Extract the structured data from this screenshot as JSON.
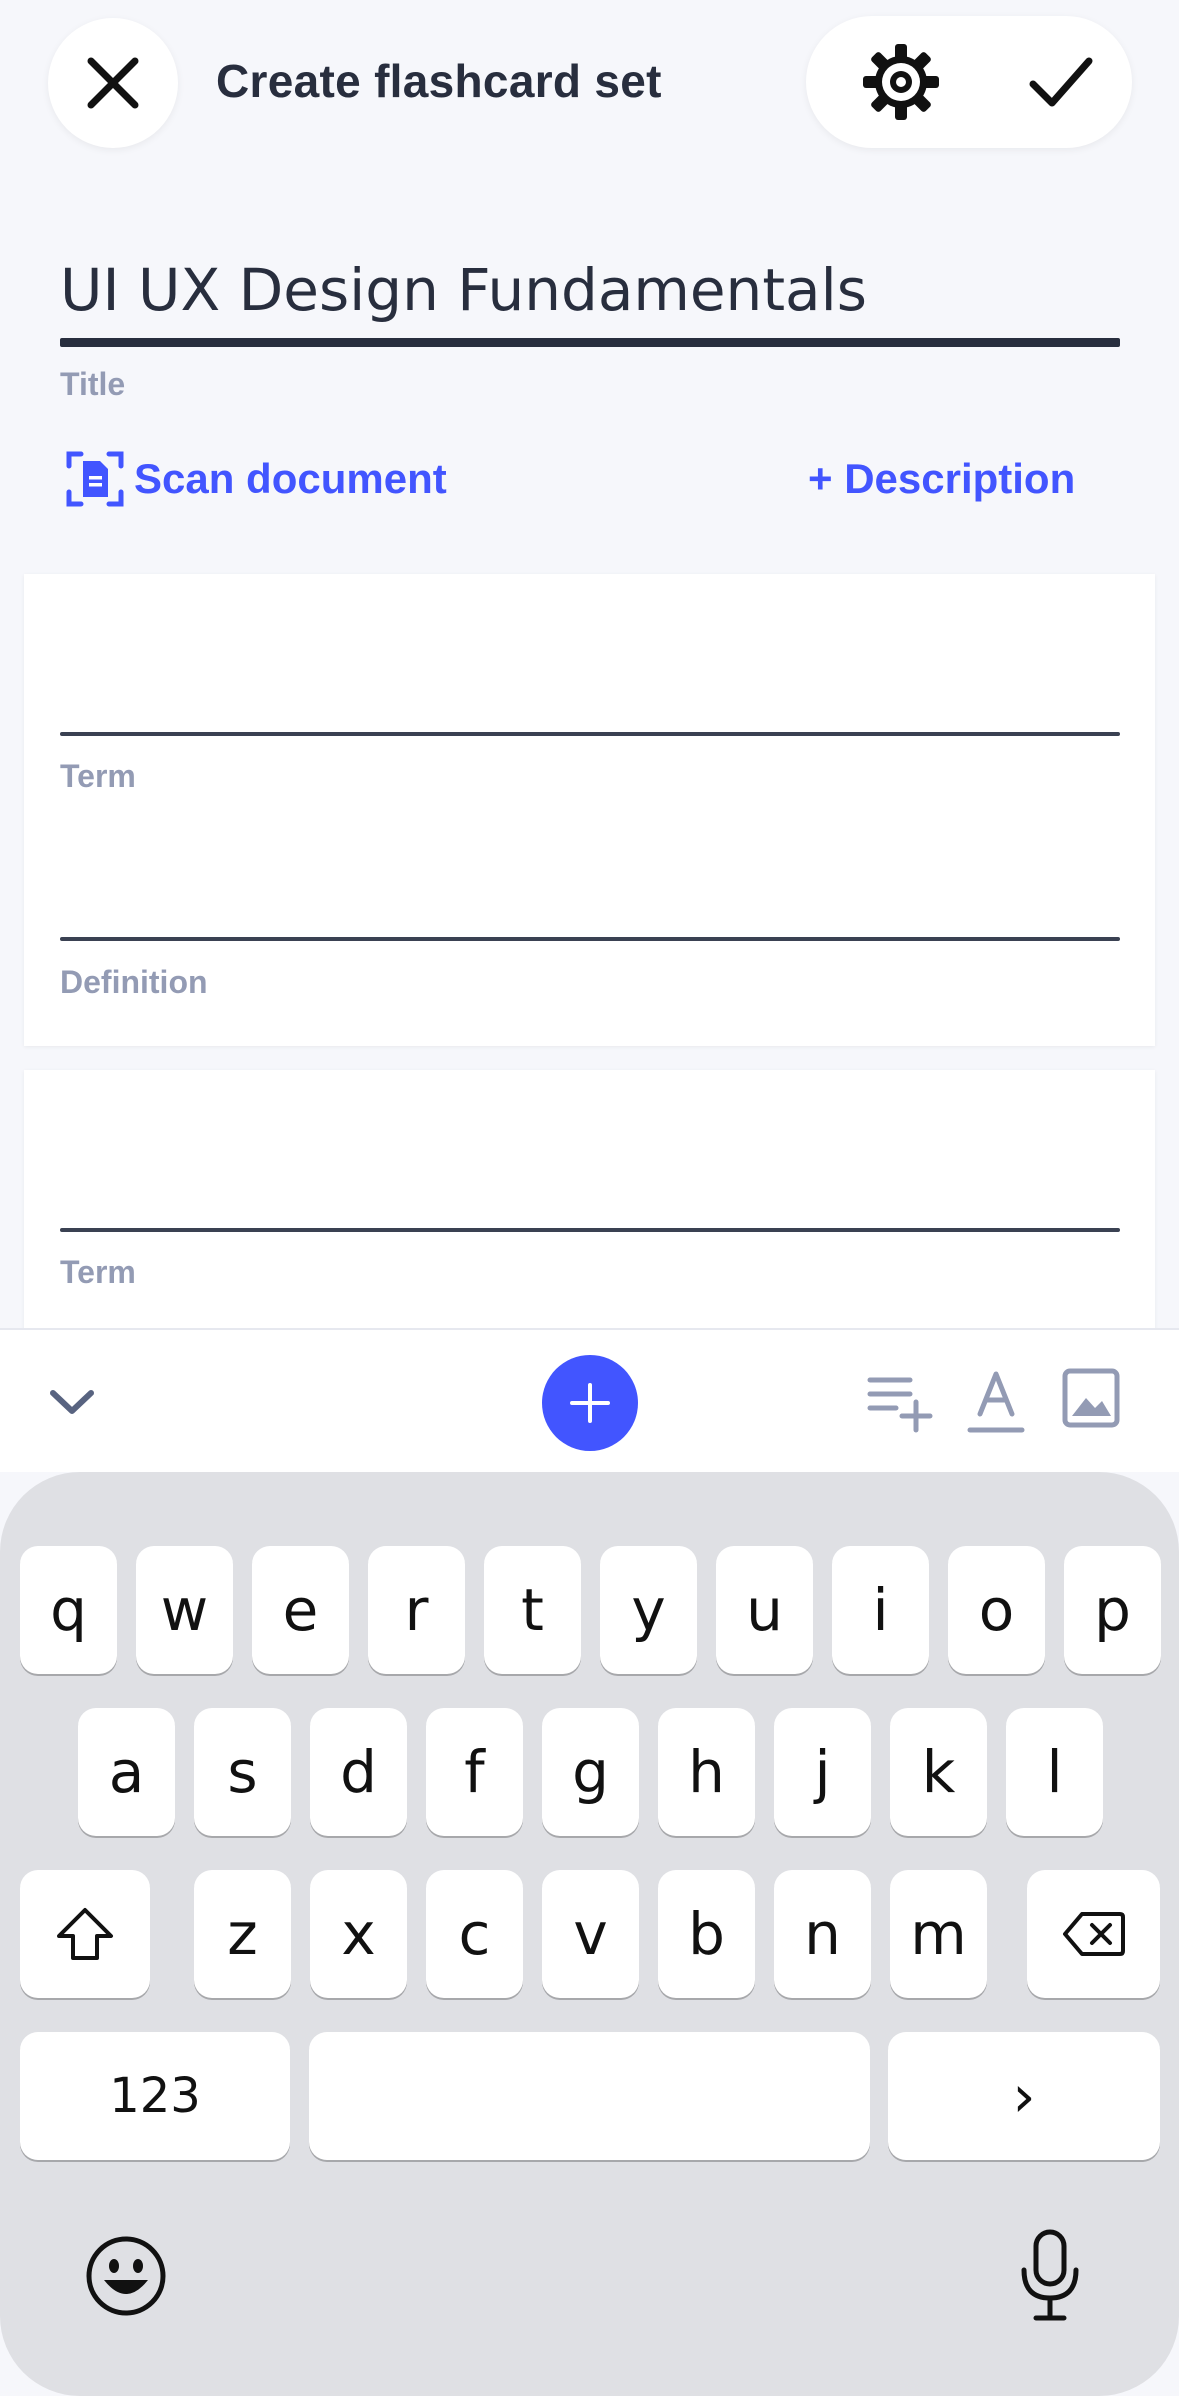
{
  "header": {
    "title": "Create flashcard set",
    "close_icon": "close-icon",
    "settings_icon": "gear-icon",
    "done_icon": "check-icon"
  },
  "set": {
    "title_value": "UI UX Design Fundamentals",
    "title_label": "Title",
    "scan_label": "Scan document",
    "description_label": "+ Description"
  },
  "cards": [
    {
      "term_label": "Term",
      "definition_label": "Definition"
    },
    {
      "term_label": "Term"
    }
  ],
  "toolbar": {
    "collapse_icon": "chevron-down-icon",
    "add_icon": "plus-icon",
    "insert_icon": "list-add-icon",
    "format_icon": "text-format-icon",
    "image_icon": "image-icon"
  },
  "keyboard": {
    "row1": [
      "q",
      "w",
      "e",
      "r",
      "t",
      "y",
      "u",
      "i",
      "o",
      "p"
    ],
    "row2": [
      "a",
      "s",
      "d",
      "f",
      "g",
      "h",
      "j",
      "k",
      "l"
    ],
    "row3": [
      "z",
      "x",
      "c",
      "v",
      "b",
      "n",
      "m"
    ],
    "numbers_label": "123",
    "next_label": "›"
  },
  "colors": {
    "accent": "#4255ff",
    "text_dark": "#282e3e",
    "label_gray": "#939bb4",
    "page_bg": "#f6f7fb",
    "keyboard_bg": "#dfe0e4"
  }
}
